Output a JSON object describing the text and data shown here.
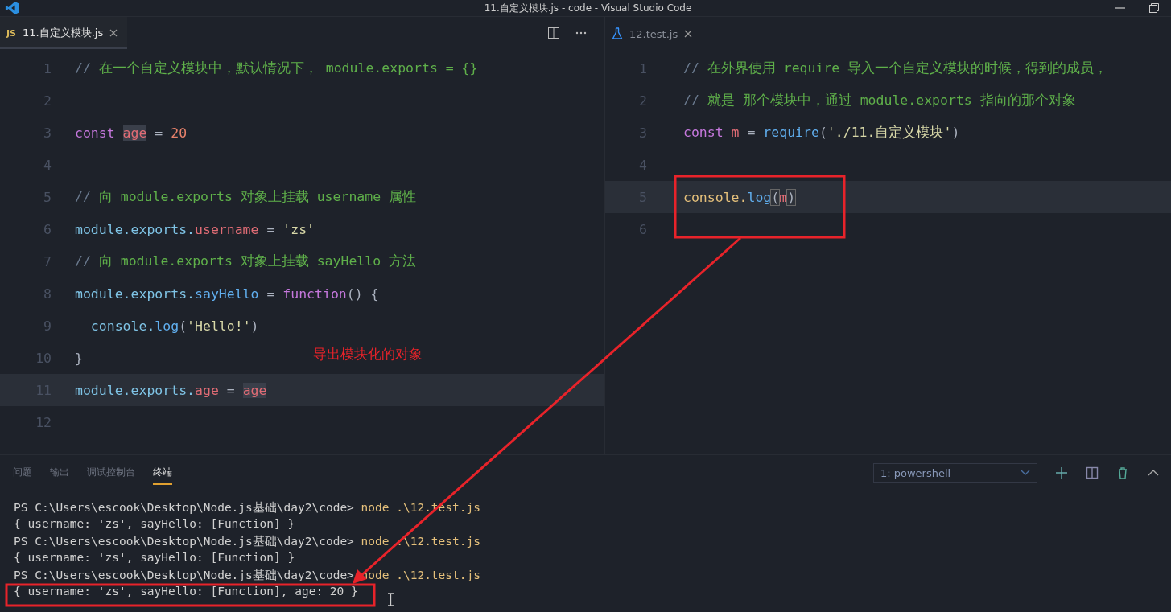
{
  "window": {
    "title": "11.自定义模块.js - code - Visual Studio Code"
  },
  "editors": [
    {
      "tab": {
        "label": "11.自定义模块.js",
        "icon": "JS",
        "kind": "js",
        "selected": true
      },
      "lines": [
        {
          "number": "1",
          "current": false,
          "tokens": [
            {
              "text": "// ",
              "kind": "comment-mark"
            },
            {
              "text": "在一个自定义模块中，默认情况下， module.exports = {}",
              "kind": "comment"
            }
          ]
        },
        {
          "number": "2",
          "current": false
        },
        {
          "number": "3",
          "current": false,
          "tokens": [
            {
              "text": "const ",
              "kind": "keyword"
            },
            {
              "text": "age",
              "kind": "var-hl"
            },
            {
              "text": " = ",
              "kind": "punct"
            },
            {
              "text": "20",
              "kind": "number"
            }
          ]
        },
        {
          "number": "4",
          "current": false
        },
        {
          "number": "5",
          "current": false,
          "tokens": [
            {
              "text": "// ",
              "kind": "comment-mark"
            },
            {
              "text": "向 module.exports 对象上挂载 username 属性",
              "kind": "comment"
            }
          ]
        },
        {
          "number": "6",
          "current": false,
          "tokens": [
            {
              "text": "module.exports.",
              "kind": "ident"
            },
            {
              "text": "username",
              "kind": "var"
            },
            {
              "text": " = ",
              "kind": "punct"
            },
            {
              "text": "'zs'",
              "kind": "string"
            }
          ]
        },
        {
          "number": "7",
          "current": false,
          "tokens": [
            {
              "text": "// ",
              "kind": "comment-mark"
            },
            {
              "text": "向 module.exports 对象上挂载 sayHello 方法",
              "kind": "comment"
            }
          ]
        },
        {
          "number": "8",
          "current": false,
          "tokens": [
            {
              "text": "module.exports.",
              "kind": "ident"
            },
            {
              "text": "sayHello",
              "kind": "func"
            },
            {
              "text": " = ",
              "kind": "punct"
            },
            {
              "text": "function",
              "kind": "keyword"
            },
            {
              "text": "() {",
              "kind": "punct"
            }
          ]
        },
        {
          "number": "9",
          "current": false,
          "tokens": [
            {
              "text": "  console.",
              "kind": "ident"
            },
            {
              "text": "log",
              "kind": "func"
            },
            {
              "text": "(",
              "kind": "punct"
            },
            {
              "text": "'Hello!'",
              "kind": "string"
            },
            {
              "text": ")",
              "kind": "punct"
            }
          ]
        },
        {
          "number": "10",
          "current": false,
          "tokens": [
            {
              "text": "}",
              "kind": "punct"
            }
          ]
        },
        {
          "number": "11",
          "current": true,
          "tokens": [
            {
              "text": "module.exports.",
              "kind": "ident"
            },
            {
              "text": "age",
              "kind": "var"
            },
            {
              "text": " = ",
              "kind": "punct"
            },
            {
              "text": "age",
              "kind": "var-hl"
            }
          ]
        },
        {
          "number": "12",
          "current": false
        }
      ]
    },
    {
      "tab": {
        "label": "12.test.js",
        "kind": "test",
        "selected": false
      },
      "lines": [
        {
          "number": "1",
          "current": false,
          "tokens": [
            {
              "text": "// ",
              "kind": "comment-mark"
            },
            {
              "text": "在外界使用 require 导入一个自定义模块的时候，得到的成员，",
              "kind": "comment"
            }
          ]
        },
        {
          "number": "2",
          "current": false,
          "tokens": [
            {
              "text": "// ",
              "kind": "comment-mark"
            },
            {
              "text": "就是 那个模块中，通过 module.exports 指向的那个对象",
              "kind": "comment"
            }
          ]
        },
        {
          "number": "3",
          "current": false,
          "tokens": [
            {
              "text": "const ",
              "kind": "keyword"
            },
            {
              "text": "m",
              "kind": "var"
            },
            {
              "text": " = ",
              "kind": "punct"
            },
            {
              "text": "require",
              "kind": "func"
            },
            {
              "text": "(",
              "kind": "punct"
            },
            {
              "text": "'./11.自定义模块'",
              "kind": "string"
            },
            {
              "text": ")",
              "kind": "punct"
            }
          ]
        },
        {
          "number": "4",
          "current": false
        },
        {
          "number": "5",
          "current": true,
          "tokens": [
            {
              "text": "console.",
              "kind": "ident-y"
            },
            {
              "text": "log",
              "kind": "func"
            },
            {
              "text": "(",
              "kind": "bracket-match"
            },
            {
              "text": "m",
              "kind": "var"
            },
            {
              "text": ")",
              "kind": "bracket-match"
            }
          ]
        },
        {
          "number": "6",
          "current": false
        }
      ]
    }
  ],
  "annotation": "导出模块化的对象",
  "panel": {
    "tabs": [
      {
        "label": "问题",
        "selected": false
      },
      {
        "label": "输出",
        "selected": false
      },
      {
        "label": "调试控制台",
        "selected": false
      },
      {
        "label": "终端",
        "selected": true
      }
    ],
    "terminal_select": "1: powershell",
    "lines": [
      {
        "kind": "prompt",
        "prompt": "PS C:\\Users\\escook\\Desktop\\Node.js基础\\day2\\code>",
        "command": " node .\\12.test.js"
      },
      {
        "kind": "output",
        "text": "{ username: 'zs', sayHello: [Function] }"
      },
      {
        "kind": "prompt",
        "prompt": "PS C:\\Users\\escook\\Desktop\\Node.js基础\\day2\\code>",
        "command": " node .\\12.test.js"
      },
      {
        "kind": "output",
        "text": "{ username: 'zs', sayHello: [Function] }"
      },
      {
        "kind": "prompt",
        "prompt": "PS C:\\Users\\escook\\Desktop\\Node.js基础\\day2\\code>",
        "command": " node .\\12.test.js"
      },
      {
        "kind": "output",
        "text": "{ username: 'zs', sayHello: [Function], age: 20 }"
      }
    ]
  }
}
